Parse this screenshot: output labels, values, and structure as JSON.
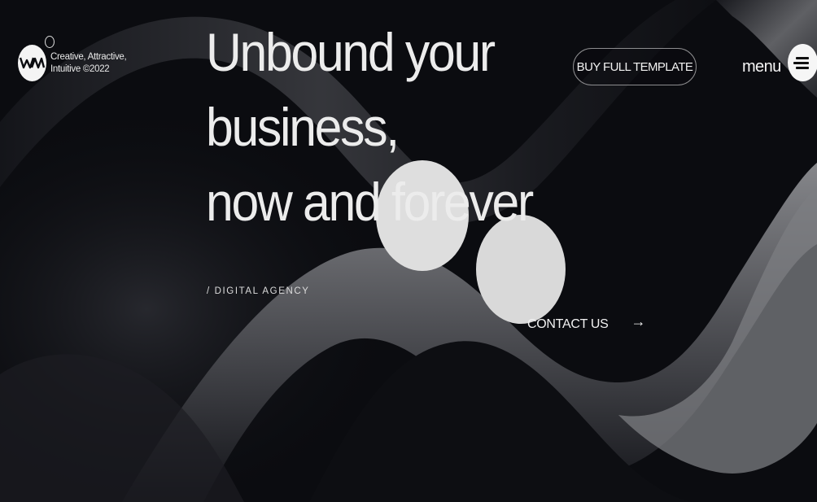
{
  "brand": {
    "logo_text_line1": "Creative, Attractive,",
    "logo_text_line2": "Intuitive ©2022"
  },
  "hero": {
    "title_lines": [
      "Unbound your",
      "business,",
      "now and forever"
    ],
    "tagline": "/ DIGITAL AGENCY"
  },
  "header": {
    "buy_button_label": "BUY FULL TEMPLATE",
    "menu_label": "menu"
  },
  "cta": {
    "contact_label": "CONTACT US",
    "contact_arrow": "→"
  },
  "icons": {
    "logo": "wm-logo-icon",
    "menu": "hamburger-menu-icon",
    "arrow": "arrow-right-icon"
  },
  "colors": {
    "background": "#0b0c10",
    "text": "#ececec",
    "accent_light": "#dcdcdc",
    "ribbon_highlight": "#8a8a8c"
  }
}
